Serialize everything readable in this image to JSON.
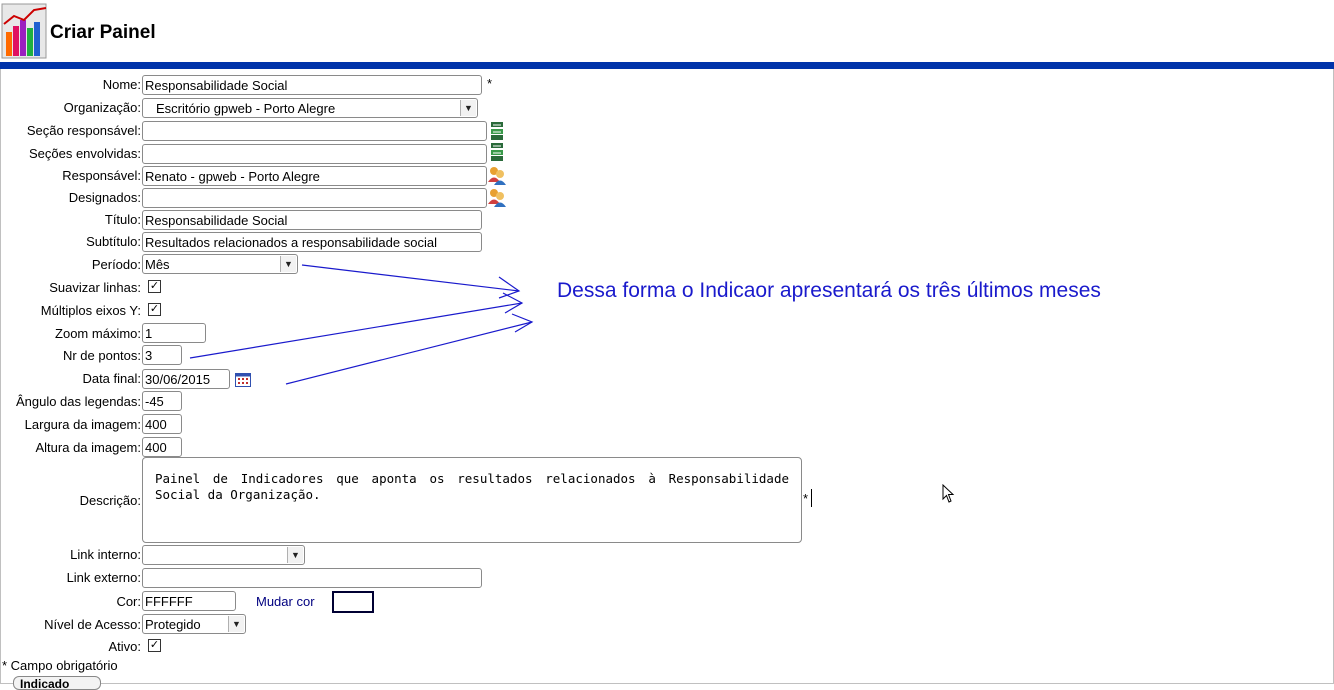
{
  "header": {
    "title": "Criar Painel"
  },
  "form": {
    "nome": {
      "label": "Nome:",
      "value": "Responsabilidade Social",
      "required": "*"
    },
    "organizacao": {
      "label": "Organização:",
      "value": "Escritório gpweb - Porto Alegre"
    },
    "secao_responsavel": {
      "label": "Seção responsável:",
      "value": ""
    },
    "secoes_envolvidas": {
      "label": "Seções envolvidas:",
      "value": ""
    },
    "responsavel": {
      "label": "Responsável:",
      "value": "Renato - gpweb - Porto Alegre"
    },
    "designados": {
      "label": "Designados:",
      "value": ""
    },
    "titulo": {
      "label": "Título:",
      "value": "Responsabilidade Social"
    },
    "subtitulo": {
      "label": "Subtítulo:",
      "value": "Resultados relacionados a responsabilidade social"
    },
    "periodo": {
      "label": "Período:",
      "value": "Mês"
    },
    "suavizar": {
      "label": "Suavizar linhas:",
      "checked": "✓"
    },
    "multiplos": {
      "label": "Múltiplos eixos Y:",
      "checked": "✓"
    },
    "zoom": {
      "label": "Zoom máximo:",
      "value": "1"
    },
    "pontos": {
      "label": "Nr de pontos:",
      "value": "3"
    },
    "data_final": {
      "label": "Data final:",
      "value": "30/06/2015"
    },
    "angulo": {
      "label": "Ângulo das legendas:",
      "value": "-45"
    },
    "largura": {
      "label": "Largura da imagem:",
      "value": "400"
    },
    "altura": {
      "label": "Altura da imagem:",
      "value": "400"
    },
    "descricao": {
      "label": "Descrição:",
      "value": "Painel de Indicadores que aponta os resultados relacionados à Responsabilidade Social da Organização.",
      "required": "*"
    },
    "link_interno": {
      "label": "Link interno:",
      "value": ""
    },
    "link_externo": {
      "label": "Link externo:",
      "value": ""
    },
    "cor": {
      "label": "Cor:",
      "value": "FFFFFF",
      "mudar_label": "Mudar cor",
      "swatch_color": "#FFFFFF"
    },
    "nivel": {
      "label": "Nível de Acesso:",
      "value": "Protegido"
    },
    "ativo": {
      "label": "Ativo:",
      "checked": "✓"
    },
    "footer_note": "* Campo obrigatório",
    "bottom_button": "Indicado"
  },
  "annotation": {
    "text": "Dessa forma o Indicaor apresentará os três últimos meses",
    "color": "#1a1acc"
  },
  "colors": {
    "header_bar": "#0033aa"
  }
}
